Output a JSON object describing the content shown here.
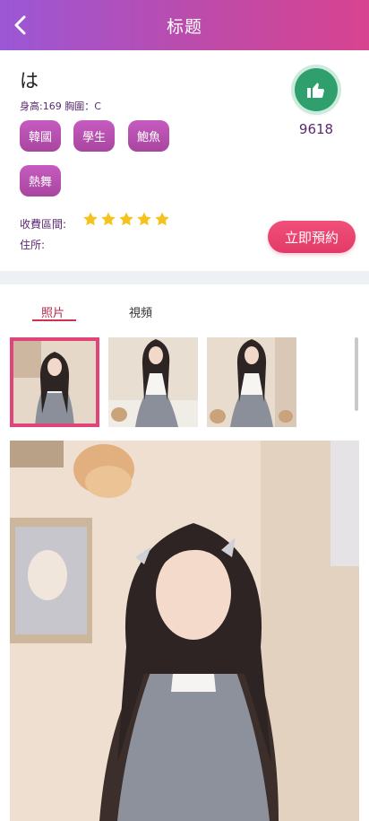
{
  "header": {
    "title": "标题",
    "back_icon": "chevron-left-icon"
  },
  "profile": {
    "name": "は",
    "stats": "身高:169 胸圍：C",
    "tags": [
      "韓國",
      "學生",
      "鮑魚",
      "熱舞"
    ],
    "price_label": "收費區間:",
    "address_label": "住所:",
    "rating": 5,
    "rating_max": 5,
    "likes": "9618",
    "book_label": "立即預約"
  },
  "tabs": {
    "photos": "照片",
    "videos": "視頻",
    "active": "photos"
  },
  "gallery": {
    "thumbnail_count": 3,
    "selected_index": 0
  },
  "colors": {
    "header_start": "#9b57d6",
    "header_end": "#d84390",
    "tag": "#b54fae",
    "like": "#2f9f6d",
    "book": "#e8456f",
    "star": "#f6c21c"
  }
}
